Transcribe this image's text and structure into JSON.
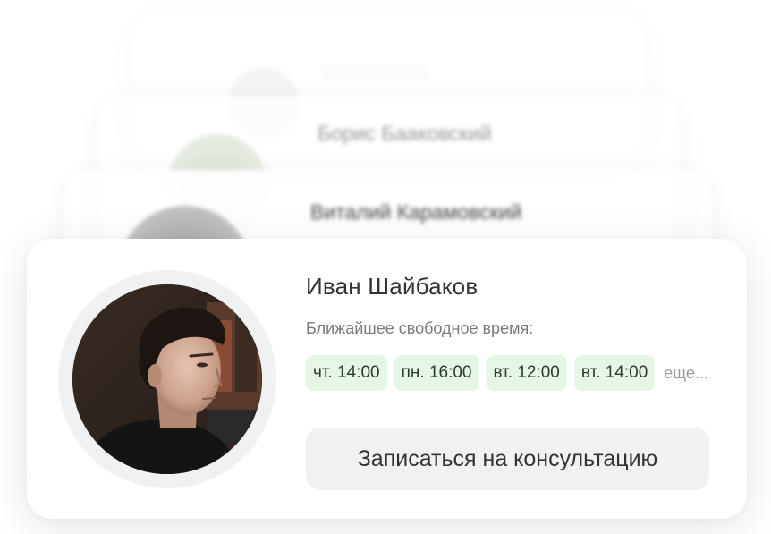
{
  "background_cards": [
    {
      "name": ""
    },
    {
      "name": "Борис Бааковский"
    },
    {
      "name": "Виталий Карамовский"
    }
  ],
  "specialist": {
    "name": "Иван Шайбаков",
    "slots_label": "Ближайшее свободное время:",
    "slots": [
      "чт. 14:00",
      "пн. 16:00",
      "вт. 12:00",
      "вт. 14:00"
    ],
    "more_label": "еще...",
    "book_button_label": "Записаться на консультацию"
  },
  "colors": {
    "slot_background": "#e6f6e4",
    "button_background": "#f0f1f3",
    "avatar_ring": "#f0f1f3"
  }
}
